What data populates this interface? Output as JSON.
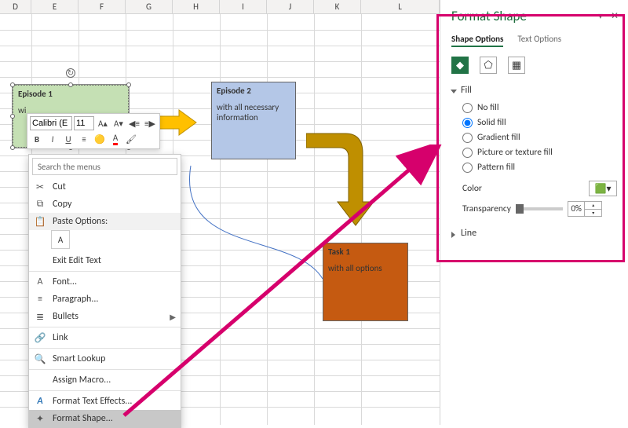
{
  "columns": [
    "D",
    "E",
    "F",
    "G",
    "H",
    "I",
    "J",
    "K",
    "L"
  ],
  "shapes": {
    "green": {
      "title": "Episode 1",
      "body": "wi"
    },
    "blue": {
      "title": "Episode 2",
      "body": "with all necessary information"
    },
    "orange": {
      "title": "Task 1",
      "body": "with all options"
    }
  },
  "mini_toolbar": {
    "font_name": "Calibri (E",
    "font_size": "11"
  },
  "context_menu": {
    "search_placeholder": "Search the menus",
    "cut": "Cut",
    "copy": "Copy",
    "paste_options": "Paste Options:",
    "paste_text": "A",
    "exit_edit": "Exit Edit Text",
    "font": "Font...",
    "paragraph": "Paragraph...",
    "bullets": "Bullets",
    "link": "Link",
    "smart_lookup": "Smart Lookup",
    "assign_macro": "Assign Macro...",
    "format_text_effects": "Format Text Effects...",
    "format_shape": "Format Shape..."
  },
  "panel": {
    "title": "Format Shape",
    "tab_shape": "Shape Options",
    "tab_text": "Text Options",
    "section_fill": "Fill",
    "section_line": "Line",
    "fill_options": {
      "none": "No fill",
      "solid": "Solid fill",
      "gradient": "Gradient fill",
      "picture": "Picture or texture fill",
      "pattern": "Pattern fill"
    },
    "color_label": "Color",
    "transparency_label": "Transparency",
    "transparency_value": "0%"
  }
}
